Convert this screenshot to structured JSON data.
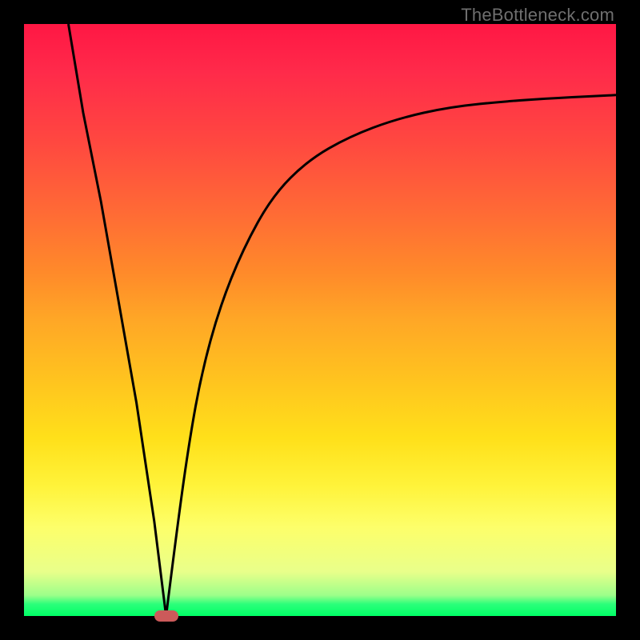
{
  "watermark": "TheBottleneck.com",
  "colors": {
    "frame": "#000000",
    "curve_stroke": "#000000",
    "marker_fill": "#cc5a5a",
    "gradient_top": "#ff1744",
    "gradient_bottom": "#00ff66"
  },
  "chart_data": {
    "type": "line",
    "title": "",
    "xlabel": "",
    "ylabel": "",
    "xlim": [
      0,
      1
    ],
    "ylim": [
      0,
      1
    ],
    "annotations": [
      {
        "kind": "marker",
        "x": 0.24,
        "y": 0.0,
        "shape": "pill",
        "color": "#cc5a5a"
      }
    ],
    "series": [
      {
        "name": "left-branch",
        "x": [
          0.075,
          0.1,
          0.13,
          0.16,
          0.19,
          0.22,
          0.24
        ],
        "y": [
          1.0,
          0.85,
          0.7,
          0.53,
          0.36,
          0.16,
          0.0
        ]
      },
      {
        "name": "right-branch",
        "x": [
          0.24,
          0.26,
          0.28,
          0.3,
          0.33,
          0.37,
          0.42,
          0.48,
          0.55,
          0.63,
          0.72,
          0.82,
          0.9,
          1.0
        ],
        "y": [
          0.0,
          0.16,
          0.3,
          0.41,
          0.52,
          0.62,
          0.71,
          0.77,
          0.81,
          0.84,
          0.86,
          0.87,
          0.875,
          0.88
        ]
      }
    ]
  }
}
